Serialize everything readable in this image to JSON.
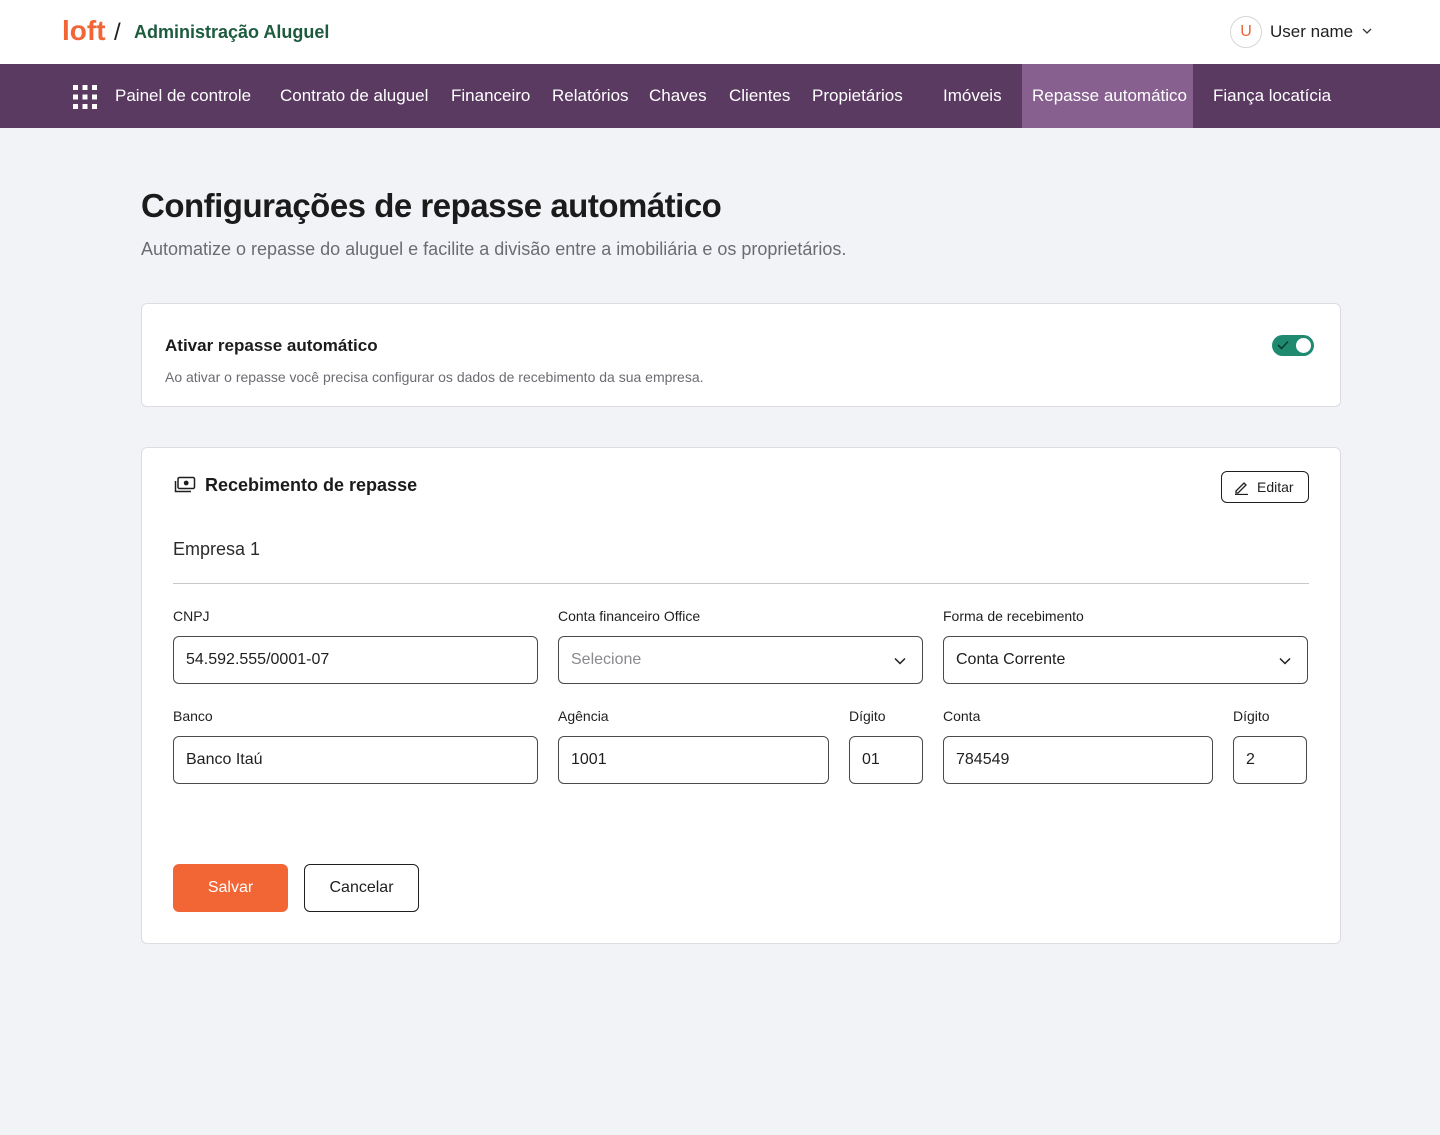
{
  "header": {
    "logo_text": "loft",
    "separator": "/",
    "app_title": "Administração Aluguel",
    "user": {
      "avatar_initial": "U",
      "name": "User name"
    }
  },
  "nav": {
    "items": [
      "Painel de controle",
      "Contrato de aluguel",
      "Financeiro",
      "Relatórios",
      "Chaves",
      "Clientes",
      "Propietários",
      "Imóveis",
      "Repasse automático",
      "Fiança locatícia"
    ],
    "active": "Repasse automático"
  },
  "page": {
    "title": "Configurações de repasse automático",
    "subtitle": "Automatize o repasse do aluguel e facilite a divisão entre a imobiliária e os proprietários."
  },
  "toggle_card": {
    "title": "Ativar repasse automático",
    "description": "Ao ativar o repasse você precisa configurar os dados de recebimento da sua empresa.",
    "enabled": true
  },
  "form": {
    "section_title": "Recebimento de repasse",
    "edit_label": "Editar",
    "company": "Empresa 1",
    "fields": {
      "cnpj": {
        "label": "CNPJ",
        "value": "54.592.555/0001-07"
      },
      "conta_office": {
        "label": "Conta financeiro Office",
        "placeholder": "Selecione"
      },
      "forma": {
        "label": "Forma de recebimento",
        "value": "Conta Corrente"
      },
      "banco": {
        "label": "Banco",
        "value": "Banco Itaú"
      },
      "agencia": {
        "label": "Agência",
        "value": "1001"
      },
      "agencia_digito": {
        "label": "Dígito",
        "value": "01"
      },
      "conta": {
        "label": "Conta",
        "value": "784549"
      },
      "conta_digito": {
        "label": "Dígito",
        "value": "2"
      }
    },
    "save_label": "Salvar",
    "cancel_label": "Cancelar"
  },
  "colors": {
    "brand_orange": "#f26535",
    "nav_bg": "#5a3a61",
    "nav_active_bg": "#87608f",
    "toggle_on": "#1f8a6f",
    "title_green": "#1d5b3f"
  }
}
